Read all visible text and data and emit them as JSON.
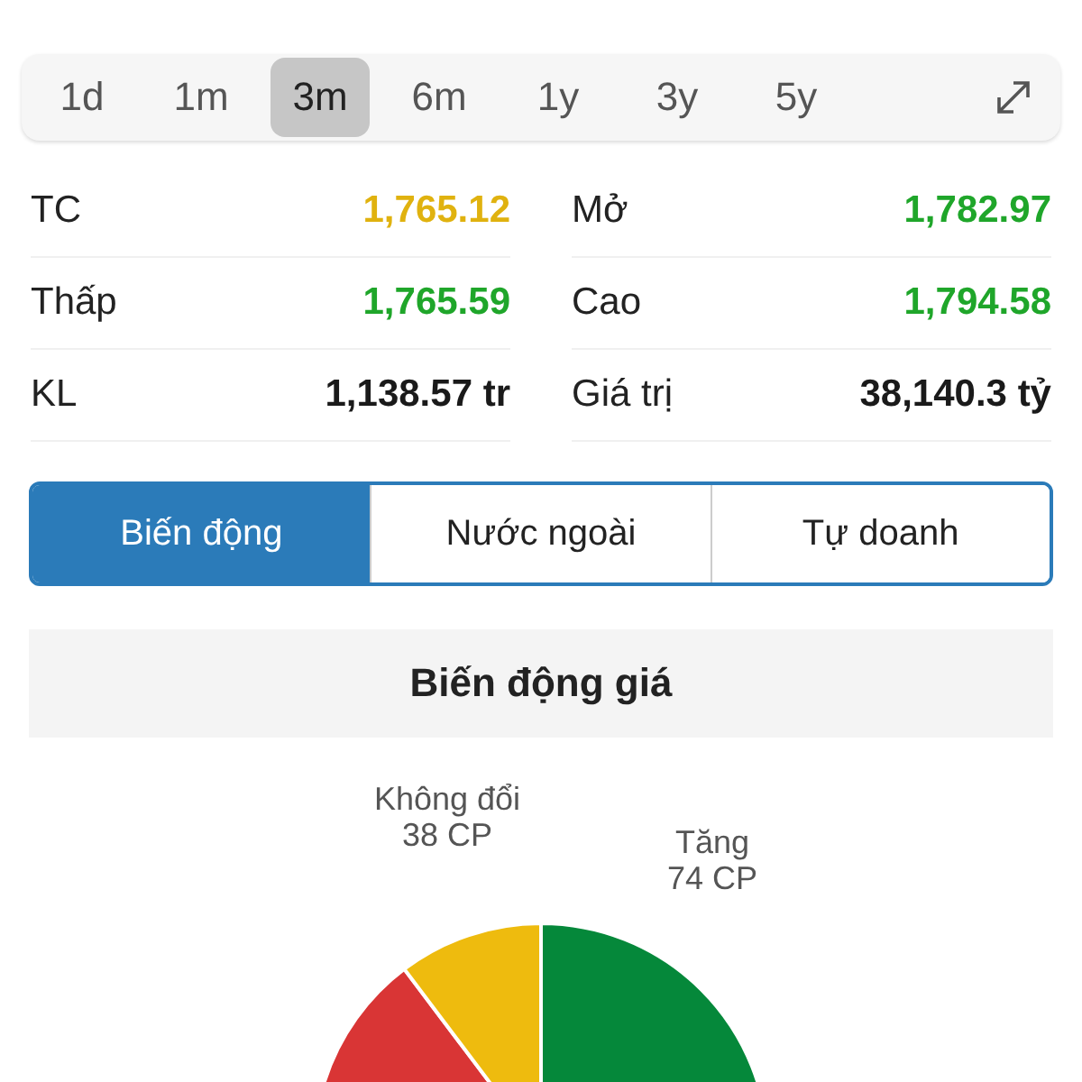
{
  "periods": [
    {
      "label": "1d",
      "selected": false
    },
    {
      "label": "1m",
      "selected": false
    },
    {
      "label": "3m",
      "selected": true
    },
    {
      "label": "6m",
      "selected": false
    },
    {
      "label": "1y",
      "selected": false
    },
    {
      "label": "3y",
      "selected": false
    },
    {
      "label": "5y",
      "selected": false
    }
  ],
  "stats": [
    {
      "label": "TC",
      "value": "1,765.12",
      "color": "#e0b20f"
    },
    {
      "label": "Mở",
      "value": "1,782.97",
      "color": "#1fa62a"
    },
    {
      "label": "Thấp",
      "value": "1,765.59",
      "color": "#1fa62a"
    },
    {
      "label": "Cao",
      "value": "1,794.58",
      "color": "#1fa62a"
    },
    {
      "label": "KL",
      "value": "1,138.57 tr",
      "color": "#1a1a1a"
    },
    {
      "label": "Giá trị",
      "value": "38,140.3 tỷ",
      "color": "#1a1a1a"
    }
  ],
  "tabs": [
    {
      "label": "Biến động",
      "selected": true
    },
    {
      "label": "Nước ngoài",
      "selected": false
    },
    {
      "label": "Tự doanh",
      "selected": false
    }
  ],
  "section_title": "Biến động giá",
  "pie_labels": [
    {
      "name": "Không đổi",
      "count": "38 CP"
    },
    {
      "name": "Tăng",
      "count": "74 CP"
    }
  ]
}
